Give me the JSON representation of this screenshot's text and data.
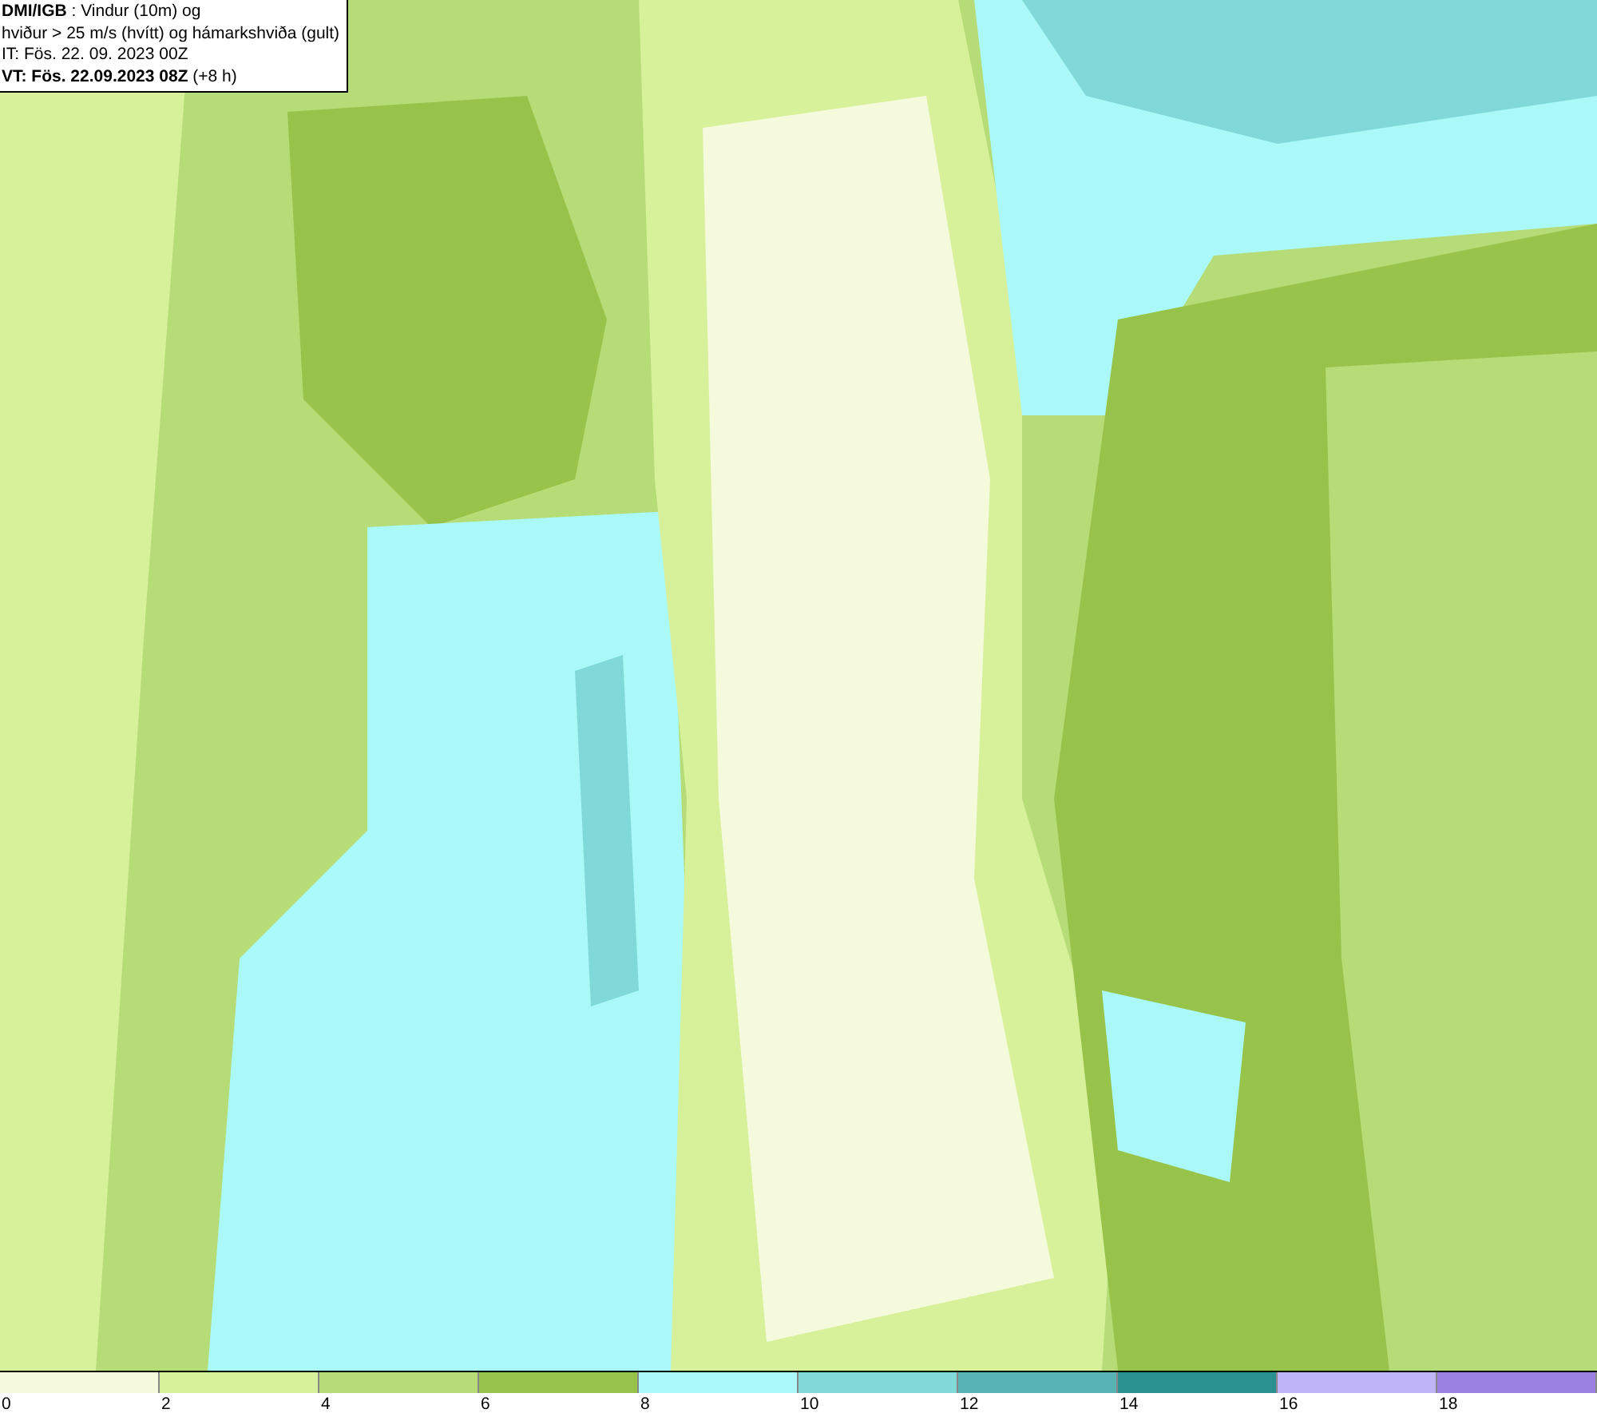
{
  "info_box": {
    "lines": [
      "**DMI/IGB** : Vindur (10m) og",
      "hviður > 25 m/s (hvítt) og hámarkshviða (gult)",
      "IT: Fös. 22. 09. 2023 00Z",
      "**VT: Fös. 22.09.2023 08Z** (+8 h)"
    ]
  },
  "legend": {
    "bins": [
      {
        "label": "0",
        "color": "#f5fadc"
      },
      {
        "label": "2",
        "color": "#d7f09a"
      },
      {
        "label": "4",
        "color": "#b6dc78"
      },
      {
        "label": "6",
        "color": "#98c34a"
      },
      {
        "label": "8",
        "color": "#aaf8f8"
      },
      {
        "label": "10",
        "color": "#80d8d8"
      },
      {
        "label": "12",
        "color": "#58b4b4"
      },
      {
        "label": "14",
        "color": "#2a9090"
      },
      {
        "label": "16",
        "color": "#c0b4f8"
      },
      {
        "label": "18",
        "color": "#9a80e0"
      }
    ]
  }
}
